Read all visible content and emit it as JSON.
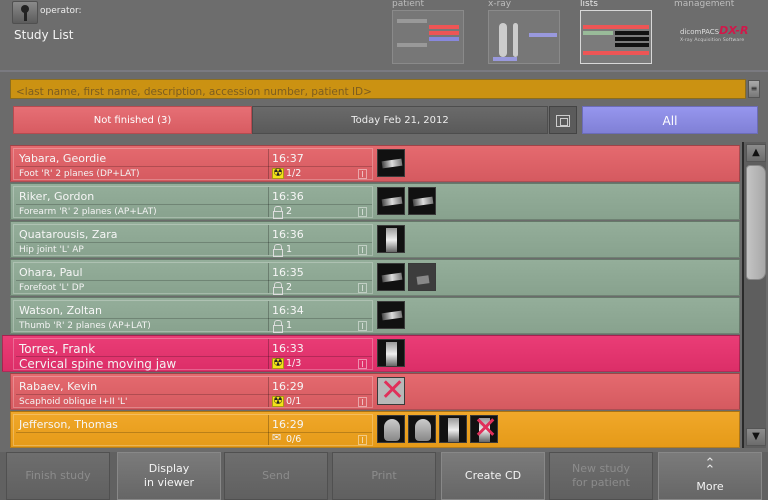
{
  "header": {
    "operator_label": "operator:",
    "page_title": "Study List",
    "nav": [
      {
        "label": "patient",
        "active": false
      },
      {
        "label": "x-ray",
        "active": false
      },
      {
        "label": "lists",
        "active": true
      },
      {
        "label": "management",
        "active": false
      }
    ],
    "brand": {
      "name_prefix": "dicomPACS",
      "name_suffix": "DX-R",
      "tagline": "X-ray Acquisition Software"
    }
  },
  "search": {
    "placeholder": "<last name, first name, description, accession number, patient ID>",
    "value": "",
    "clear_label": "≡"
  },
  "filters": {
    "not_finished": "Not finished (3)",
    "date": "Today Feb 21, 2012",
    "all": "All"
  },
  "colors": {
    "not_finished": "#e06468",
    "finished": "#8fa994",
    "selected": "#e33670",
    "in_progress": "#eba221",
    "all_filter": "#8c8ce2",
    "search_bg": "#cb9212"
  },
  "studies": [
    {
      "name": "Yabara, Geordie",
      "description": "Foot 'R' 2 planes (DP+LAT)",
      "time": "16:37",
      "status_icon": "radiation-icon",
      "count": "1/2",
      "state": "red",
      "thumbs": [
        "horizontal"
      ]
    },
    {
      "name": "Riker, Gordon",
      "description": "Forearm 'R' 2 planes (AP+LAT)",
      "time": "16:36",
      "status_icon": "lock-icon",
      "count": "2",
      "state": "green",
      "thumbs": [
        "horizontal",
        "horizontal"
      ]
    },
    {
      "name": "Quatarousis, Zara",
      "description": "Hip joint 'L' AP",
      "time": "16:36",
      "status_icon": "lock-icon",
      "count": "1",
      "state": "green",
      "thumbs": [
        "vertical"
      ]
    },
    {
      "name": "Ohara, Paul",
      "description": "Forefoot 'L' DP",
      "time": "16:35",
      "status_icon": "lock-icon",
      "count": "2",
      "state": "green",
      "thumbs": [
        "horizontal",
        "grey"
      ]
    },
    {
      "name": "Watson, Zoltan",
      "description": "Thumb 'R' 2 planes (AP+LAT)",
      "time": "16:34",
      "status_icon": "lock-icon",
      "count": "1",
      "state": "green",
      "thumbs": [
        "horizontal"
      ]
    },
    {
      "name": "Torres, Frank",
      "description": "Cervical spine moving jaw",
      "time": "16:33",
      "status_icon": "radiation-icon",
      "count": "1/3",
      "state": "pink",
      "thumbs": [
        "vertical"
      ]
    },
    {
      "name": "Rabaev, Kevin",
      "description": "Scaphoid oblique I+II 'L'",
      "time": "16:29",
      "status_icon": "radiation-icon",
      "count": "0/1",
      "state": "red",
      "thumbs": [
        "light-rejected"
      ]
    },
    {
      "name": "Jefferson, Thomas",
      "description": "",
      "time": "16:29",
      "status_icon": "mail-icon",
      "count": "0/6",
      "state": "orange",
      "thumbs": [
        "head",
        "head",
        "vertical",
        "vertical-rejected"
      ]
    }
  ],
  "scrollbar": {
    "up": "▲",
    "down": "▼"
  },
  "buttons": [
    {
      "label": "Finish study",
      "enabled": false
    },
    {
      "label": "Display\nin viewer",
      "enabled": true
    },
    {
      "label": "Send",
      "enabled": false
    },
    {
      "label": "Print",
      "enabled": false
    },
    {
      "label": "Create CD",
      "enabled": true
    },
    {
      "label": "New study\nfor patient",
      "enabled": false
    },
    {
      "label": "More",
      "enabled": true,
      "icon": "chevron-double-up-icon"
    }
  ]
}
